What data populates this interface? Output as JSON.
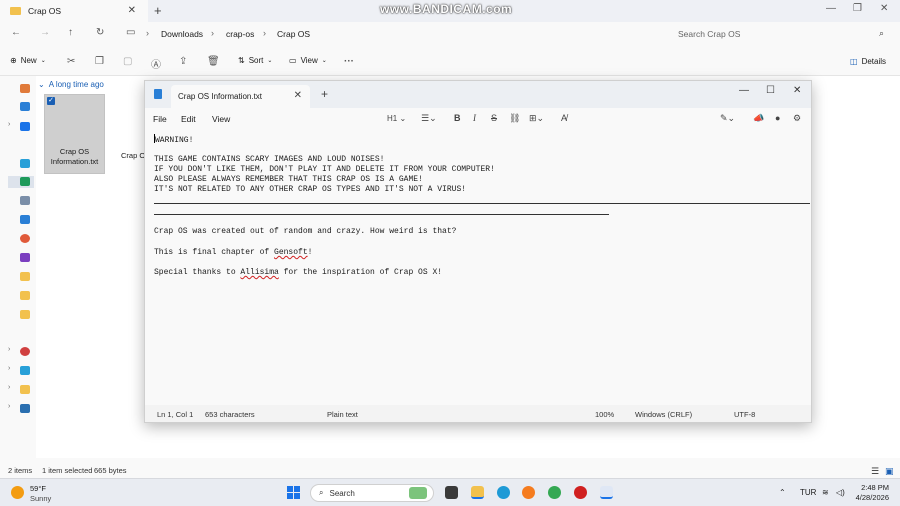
{
  "watermark": "www.BANDICAM.com",
  "explorer": {
    "tab_title": "Crap OS",
    "breadcrumb": [
      "Downloads",
      "crap-os",
      "Crap OS"
    ],
    "search_placeholder": "Search Crap OS",
    "commands": {
      "new": "New",
      "sort": "Sort",
      "view": "View",
      "details": "Details"
    },
    "group_header": "A long time ago",
    "files": [
      {
        "name_line1": "Crap OS",
        "name_line2": "Information.txt",
        "selected": true
      },
      {
        "name": "Crap O"
      }
    ],
    "status": {
      "items": "2 items",
      "selected": "1 item selected",
      "size": "665 bytes"
    }
  },
  "notepad": {
    "tab_title": "Crap OS Information.txt",
    "menu": {
      "file": "File",
      "edit": "Edit",
      "view": "View"
    },
    "heading_selector": "H1",
    "lines": {
      "l1": "WARNING!",
      "l2": "THIS GAME CONTAINS SCARY IMAGES AND LOUD NOISES!",
      "l3": "IF YOU DON'T LIKE THEM, DON'T PLAY IT AND DELETE IT FROM YOUR COMPUTER!",
      "l4": "ALSO PLEASE ALWAYS REMEMBER THAT THIS CRAP OS IS A GAME!",
      "l5": "IT'S NOT RELATED TO ANY OTHER CRAP OS TYPES AND IT'S NOT A VIRUS!",
      "l6": "Crap OS was created out of random and crazy. How weird is that?",
      "l7a": "This is final chapter of ",
      "l7b": "Gensoft",
      "l7c": "!",
      "l8a": "Special thanks to ",
      "l8b": "Allisima",
      "l8c": " for the inspiration of Crap OS X!"
    },
    "status": {
      "position": "Ln 1, Col 1",
      "characters": "653 characters",
      "format": "Plain text",
      "zoom": "100%",
      "line_ending": "Windows (CRLF)",
      "encoding": "UTF-8"
    }
  },
  "taskbar": {
    "weather_temp": "59°F",
    "weather_cond": "Sunny",
    "search_label": "Search",
    "language": "TUR",
    "time": "2:48 PM",
    "date": "4/28/2026"
  },
  "colors": {
    "accent": "#1a5fb4",
    "folder": "#f2c14e",
    "selection": "#cfcfcf"
  }
}
